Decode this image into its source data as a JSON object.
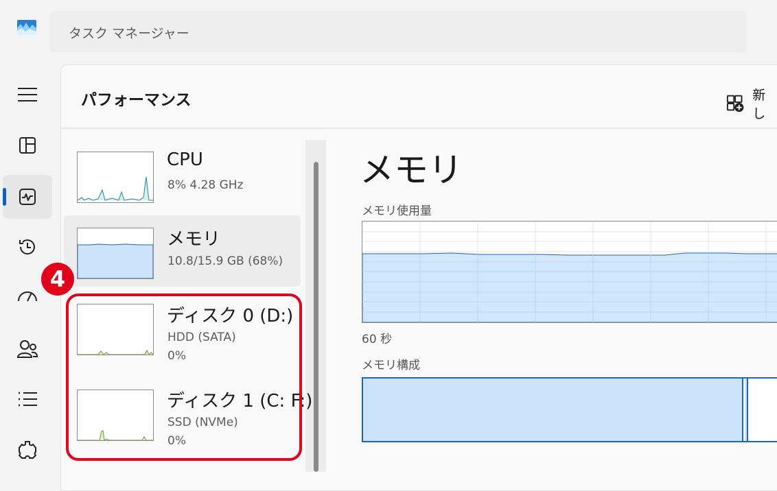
{
  "app": {
    "title": "タスク マネージャー"
  },
  "header": {
    "page_title": "パフォーマンス",
    "new_task_label": "新し"
  },
  "nav": {
    "items": [
      {
        "name": "hamburger-menu-icon"
      },
      {
        "name": "processes-icon"
      },
      {
        "name": "performance-icon",
        "active": true
      },
      {
        "name": "app-history-icon"
      },
      {
        "name": "startup-apps-icon"
      },
      {
        "name": "users-icon"
      },
      {
        "name": "details-icon"
      },
      {
        "name": "services-icon"
      }
    ]
  },
  "badge": {
    "number": "4"
  },
  "list": {
    "items": [
      {
        "name": "CPU",
        "sub1": "8%  4.28 GHz",
        "sub2": ""
      },
      {
        "name": "メモリ",
        "sub1": "10.8/15.9 GB (68%)",
        "sub2": "",
        "selected": true
      },
      {
        "name": "ディスク 0 (D:)",
        "sub1": "HDD (SATA)",
        "sub2": "0%"
      },
      {
        "name": "ディスク 1 (C: F:)",
        "sub1": "SSD (NVMe)",
        "sub2": "0%"
      }
    ]
  },
  "detail": {
    "title": "メモリ",
    "usage_label": "メモリ使用量",
    "time_label": "60 秒",
    "composition_label": "メモリ構成",
    "composition_in_use_fraction": 0.89
  },
  "colors": {
    "accent": "#1060c4",
    "memory_fill": "#cce4fb",
    "memory_line": "#1f66b6",
    "cpu_line": "#1a8a9a",
    "disk_line": "#6a9a1f",
    "highlight": "#e3001b"
  }
}
